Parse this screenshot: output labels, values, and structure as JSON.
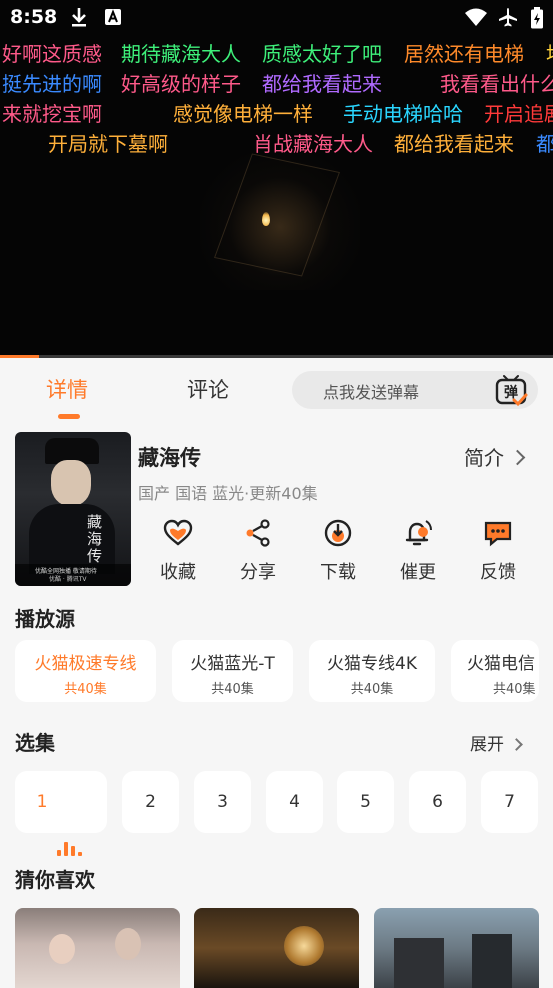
{
  "status_bar": {
    "time": "8:58",
    "icons": [
      "download-icon",
      "app-a-icon",
      "wifi-icon",
      "airplane-icon",
      "battery-charging-icon"
    ]
  },
  "danmaku": [
    {
      "text": "好啊这质感",
      "color": "#ff5a8a"
    },
    {
      "text": "期待藏海大人",
      "color": "#3ef07a"
    },
    {
      "text": "质感太好了吧",
      "color": "#3ef07a"
    },
    {
      "text": "居然还有电梯",
      "color": "#ff8a2a"
    },
    {
      "text": "地",
      "color": "#ffd23a"
    },
    {
      "text": "挺先进的啊",
      "color": "#3a8aff"
    },
    {
      "text": "好高级的样子",
      "color": "#ff5a8a"
    },
    {
      "text": "都给我看起来",
      "color": "#b06aff"
    },
    {
      "text": "我看看出什么",
      "color": "#ff5a8a"
    },
    {
      "text": "来就挖宝啊",
      "color": "#ff5a8a"
    },
    {
      "text": "感觉像电梯一样",
      "color": "#ffb03a"
    },
    {
      "text": "手动电梯哈哈",
      "color": "#2ad6ff"
    },
    {
      "text": "开启追剧",
      "color": "#ff3a3a"
    },
    {
      "text": "开局就下墓啊",
      "color": "#ffb03a"
    },
    {
      "text": "肖战藏海大人",
      "color": "#ff5a8a"
    },
    {
      "text": "都给我看起来",
      "color": "#ffb03a"
    },
    {
      "text": "都",
      "color": "#3a8aff"
    }
  ],
  "player": {
    "progress": 0.07
  },
  "tabs": {
    "details": "详情",
    "comments": "评论"
  },
  "danmu_input": {
    "placeholder": "点我发送弹幕",
    "icon_label": "弹"
  },
  "show": {
    "poster_title": "藏海传",
    "poster_line1": "优酷全网独播 敬请期待",
    "poster_line2": "优酷 · 腾讯TV",
    "title": "藏海传",
    "meta": "国产 国语 蓝光·更新40集",
    "intro_label": "简介"
  },
  "actions": [
    {
      "label": "收藏",
      "icon": "heart-icon"
    },
    {
      "label": "分享",
      "icon": "share-icon"
    },
    {
      "label": "下载",
      "icon": "download-icon"
    },
    {
      "label": "催更",
      "icon": "bell-icon"
    },
    {
      "label": "反馈",
      "icon": "feedback-icon"
    }
  ],
  "sources": {
    "title": "播放源",
    "items": [
      {
        "name": "火猫极速专线",
        "count": "共40集",
        "active": true
      },
      {
        "name": "火猫蓝光-T",
        "count": "共40集",
        "active": false
      },
      {
        "name": "火猫专线4K",
        "count": "共40集",
        "active": false
      },
      {
        "name": "火猫电信",
        "count": "共40集",
        "active": false
      }
    ]
  },
  "episodes": {
    "title": "选集",
    "expand_label": "展开",
    "items": [
      "1",
      "2",
      "3",
      "4",
      "5",
      "6",
      "7"
    ],
    "active": "1"
  },
  "recommend": {
    "title": "猜你喜欢"
  },
  "colors": {
    "accent": "#ff7a2a",
    "background": "#f6f6f6",
    "card": "#ffffff"
  }
}
